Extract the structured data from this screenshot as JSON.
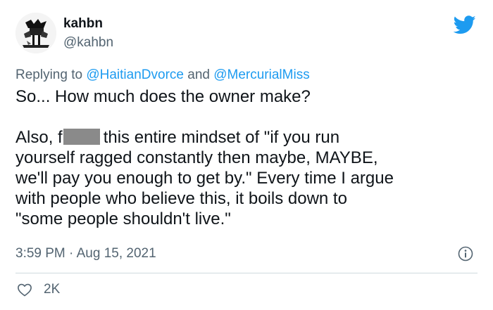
{
  "user": {
    "display_name": "kahbn",
    "handle": "@kahbn",
    "avatar_icon": "avatar-illustration"
  },
  "reply": {
    "prefix": "Replying to",
    "mention_1": "@HaitianDvorce",
    "conjunction": "and",
    "mention_2": "@MercurialMiss"
  },
  "tweet": {
    "line_1": "So... How much does the owner make?",
    "line_2_before_censor": "Also, f",
    "line_2_after_censor": "this entire mindset of \"if you run",
    "line_3": "yourself ragged constantly then maybe, MAYBE,",
    "line_4": "we'll pay you enough to get by.\" Every time I argue",
    "line_5": "with people who believe this, it boils down to",
    "line_6": "\"some people shouldn't live.\""
  },
  "meta": {
    "time": "3:59 PM",
    "separator": "·",
    "date": "Aug 15, 2021"
  },
  "actions": {
    "like_count": "2K"
  },
  "colors": {
    "twitter_blue": "#1d9bf0",
    "secondary_text": "#536471",
    "primary_text": "#0f1419",
    "censor_bar": "#8a8a8a",
    "divider": "#cfd9de"
  },
  "icons": [
    "twitter-bird-icon",
    "info-icon",
    "heart-icon"
  ]
}
